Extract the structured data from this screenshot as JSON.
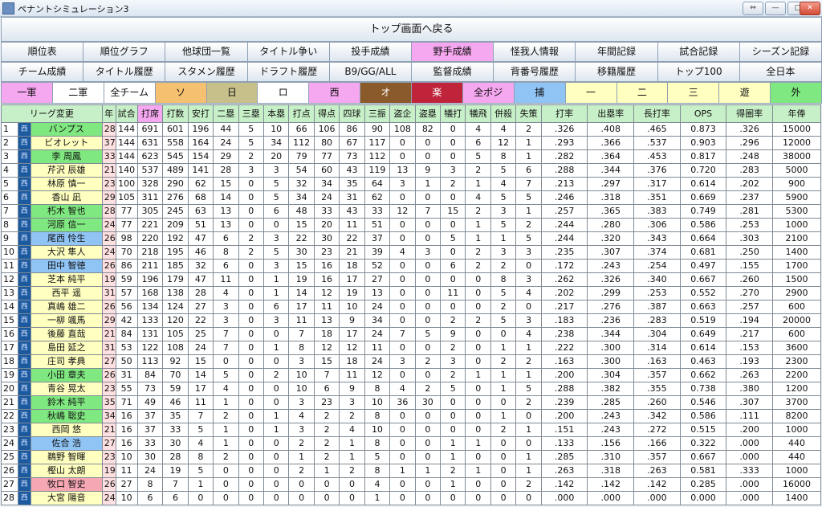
{
  "window": {
    "title": "ペナントシミュレーション3"
  },
  "top_button": "トップ画面へ戻る",
  "nav_row1": [
    "順位表",
    "順位グラフ",
    "他球団一覧",
    "タイトル争い",
    "投手成績",
    "野手成績",
    "怪我人情報",
    "年間記録",
    "試合記録",
    "シーズン記録"
  ],
  "nav_row2": [
    "チーム成績",
    "タイトル履歴",
    "スタメン履歴",
    "ドラフト履歴",
    "B9/GG/ALL",
    "監督成績",
    "背番号履歴",
    "移籍履歴",
    "トップ100",
    "全日本"
  ],
  "active_nav": "野手成績",
  "filters": [
    {
      "label": "一軍",
      "color": "#f5a7ef"
    },
    {
      "label": "二軍",
      "color": "#ffffff"
    },
    {
      "label": "全チーム",
      "color": "#ffffff"
    },
    {
      "label": "ソ",
      "color": "#f5c070"
    },
    {
      "label": "日",
      "color": "#c8c08a"
    },
    {
      "label": "ロ",
      "color": "#ffffff"
    },
    {
      "label": "西",
      "color": "#f5a7ef"
    },
    {
      "label": "オ",
      "color": "#8b5a2b"
    },
    {
      "label": "楽",
      "color": "#c0243a"
    },
    {
      "label": "全ポジ",
      "color": "#f5a7ef"
    },
    {
      "label": "捕",
      "color": "#8fc4f5"
    },
    {
      "label": "一",
      "color": "#ffffc0"
    },
    {
      "label": "二",
      "color": "#ffffc0"
    },
    {
      "label": "三",
      "color": "#ffffc0"
    },
    {
      "label": "遊",
      "color": "#ffffc0"
    },
    {
      "label": "外",
      "color": "#80e880"
    }
  ],
  "table": {
    "columns": [
      "リーグ変更",
      "年",
      "試合",
      "打席",
      "打数",
      "安打",
      "二塁",
      "三塁",
      "本塁",
      "打点",
      "得点",
      "四球",
      "三振",
      "盗企",
      "盗塁",
      "犠打",
      "犠飛",
      "併殺",
      "失策",
      "打率",
      "出塁率",
      "長打率",
      "OPS",
      "得圏率",
      "年俸"
    ],
    "team_code": "西",
    "rows": [
      {
        "no": "1",
        "name": "バンプス",
        "pos": "外",
        "cells": [
          "28",
          "144",
          "691",
          "601",
          "196",
          "44",
          "5",
          "10",
          "66",
          "106",
          "86",
          "90",
          "108",
          "82",
          "0",
          "4",
          "4",
          "2",
          ".326",
          ".408",
          ".465",
          "0.873",
          ".326",
          "15000"
        ]
      },
      {
        "no": "2",
        "name": "ビオレット",
        "pos": "一",
        "cells": [
          "37",
          "144",
          "631",
          "558",
          "164",
          "24",
          "5",
          "34",
          "112",
          "80",
          "67",
          "117",
          "0",
          "0",
          "0",
          "6",
          "12",
          "1",
          ".293",
          ".366",
          ".537",
          "0.903",
          ".296",
          "12000"
        ]
      },
      {
        "no": "3",
        "name": "李 周鳳",
        "pos": "外",
        "cells": [
          "33",
          "144",
          "623",
          "545",
          "154",
          "29",
          "2",
          "20",
          "79",
          "77",
          "73",
          "112",
          "0",
          "0",
          "0",
          "5",
          "8",
          "1",
          ".282",
          ".364",
          ".453",
          "0.817",
          ".248",
          "38000"
        ]
      },
      {
        "no": "4",
        "name": "芹沢 辰雄",
        "pos": "二",
        "cells": [
          "21",
          "140",
          "537",
          "489",
          "141",
          "28",
          "3",
          "3",
          "54",
          "60",
          "43",
          "119",
          "13",
          "9",
          "3",
          "2",
          "5",
          "6",
          ".288",
          ".344",
          ".376",
          "0.720",
          ".283",
          "5000"
        ]
      },
      {
        "no": "5",
        "name": "林原 慎一",
        "pos": "三",
        "cells": [
          "23",
          "100",
          "328",
          "290",
          "62",
          "15",
          "0",
          "5",
          "32",
          "34",
          "35",
          "64",
          "3",
          "1",
          "2",
          "1",
          "4",
          "7",
          ".213",
          ".297",
          ".317",
          "0.614",
          ".202",
          "900"
        ]
      },
      {
        "no": "6",
        "name": "香山 凪",
        "pos": "一",
        "cells": [
          "29",
          "105",
          "311",
          "276",
          "68",
          "14",
          "0",
          "5",
          "34",
          "24",
          "31",
          "62",
          "0",
          "0",
          "0",
          "4",
          "5",
          "5",
          ".246",
          ".318",
          ".351",
          "0.669",
          ".237",
          "5900"
        ]
      },
      {
        "no": "7",
        "name": "朽木 智也",
        "pos": "外",
        "cells": [
          "28",
          "77",
          "305",
          "245",
          "63",
          "13",
          "0",
          "6",
          "48",
          "33",
          "43",
          "33",
          "12",
          "7",
          "15",
          "2",
          "3",
          "1",
          ".257",
          ".365",
          ".383",
          "0.749",
          ".281",
          "5300"
        ]
      },
      {
        "no": "8",
        "name": "河原 信一",
        "pos": "外",
        "cells": [
          "24",
          "77",
          "221",
          "209",
          "51",
          "13",
          "0",
          "0",
          "15",
          "20",
          "11",
          "51",
          "0",
          "0",
          "0",
          "1",
          "5",
          "2",
          ".244",
          ".280",
          ".306",
          "0.586",
          ".253",
          "1000"
        ]
      },
      {
        "no": "9",
        "name": "尾西 怜生",
        "pos": "捕",
        "cells": [
          "26",
          "98",
          "220",
          "192",
          "47",
          "6",
          "2",
          "3",
          "22",
          "30",
          "22",
          "37",
          "0",
          "0",
          "5",
          "1",
          "1",
          "5",
          ".244",
          ".320",
          ".343",
          "0.664",
          ".303",
          "2100"
        ]
      },
      {
        "no": "10",
        "name": "大沢 隼人",
        "pos": "遊",
        "cells": [
          "24",
          "70",
          "218",
          "195",
          "46",
          "8",
          "2",
          "5",
          "30",
          "23",
          "21",
          "39",
          "4",
          "3",
          "0",
          "2",
          "3",
          "3",
          ".235",
          ".307",
          ".374",
          "0.681",
          ".250",
          "1400"
        ]
      },
      {
        "no": "11",
        "name": "田中 智徳",
        "pos": "捕",
        "cells": [
          "26",
          "86",
          "211",
          "185",
          "32",
          "6",
          "0",
          "3",
          "15",
          "16",
          "18",
          "52",
          "0",
          "0",
          "6",
          "2",
          "2",
          "0",
          ".172",
          ".243",
          ".254",
          "0.497",
          ".155",
          "1700"
        ]
      },
      {
        "no": "12",
        "name": "芝本 純平",
        "pos": "一",
        "cells": [
          "19",
          "59",
          "196",
          "179",
          "47",
          "11",
          "0",
          "1",
          "19",
          "16",
          "17",
          "27",
          "0",
          "0",
          "0",
          "0",
          "8",
          "3",
          ".262",
          ".326",
          ".340",
          "0.667",
          ".260",
          "1500"
        ]
      },
      {
        "no": "13",
        "name": "西平 遥",
        "pos": "一",
        "cells": [
          "31",
          "57",
          "168",
          "138",
          "28",
          "4",
          "0",
          "1",
          "14",
          "12",
          "19",
          "13",
          "0",
          "0",
          "11",
          "0",
          "5",
          "4",
          ".202",
          ".299",
          ".253",
          "0.552",
          ".270",
          "2900"
        ]
      },
      {
        "no": "14",
        "name": "真嶋 雄二",
        "pos": "一",
        "cells": [
          "26",
          "56",
          "134",
          "124",
          "27",
          "3",
          "0",
          "6",
          "17",
          "11",
          "10",
          "24",
          "0",
          "0",
          "0",
          "0",
          "2",
          "0",
          ".217",
          ".276",
          ".387",
          "0.663",
          ".257",
          "600"
        ]
      },
      {
        "no": "15",
        "name": "一柳 颯馬",
        "pos": "一",
        "cells": [
          "29",
          "42",
          "133",
          "120",
          "22",
          "3",
          "0",
          "3",
          "11",
          "13",
          "9",
          "34",
          "0",
          "0",
          "2",
          "2",
          "5",
          "3",
          ".183",
          ".236",
          ".283",
          "0.519",
          ".194",
          "20000"
        ]
      },
      {
        "no": "16",
        "name": "後藤 直哉",
        "pos": "二",
        "cells": [
          "21",
          "84",
          "131",
          "105",
          "25",
          "7",
          "0",
          "0",
          "7",
          "18",
          "17",
          "24",
          "7",
          "5",
          "9",
          "0",
          "0",
          "4",
          ".238",
          ".344",
          ".304",
          "0.649",
          ".217",
          "600"
        ]
      },
      {
        "no": "17",
        "name": "島田 延之",
        "pos": "一",
        "cells": [
          "31",
          "53",
          "122",
          "108",
          "24",
          "7",
          "0",
          "1",
          "8",
          "12",
          "12",
          "11",
          "0",
          "0",
          "2",
          "0",
          "1",
          "1",
          ".222",
          ".300",
          ".314",
          "0.614",
          ".153",
          "3600"
        ]
      },
      {
        "no": "18",
        "name": "庄司 孝典",
        "pos": "二",
        "cells": [
          "27",
          "50",
          "113",
          "92",
          "15",
          "0",
          "0",
          "0",
          "3",
          "15",
          "18",
          "24",
          "3",
          "2",
          "3",
          "0",
          "2",
          "2",
          ".163",
          ".300",
          ".163",
          "0.463",
          ".193",
          "2300"
        ]
      },
      {
        "no": "19",
        "name": "小田 章夫",
        "pos": "外",
        "cells": [
          "26",
          "31",
          "84",
          "70",
          "14",
          "5",
          "0",
          "2",
          "10",
          "7",
          "11",
          "12",
          "0",
          "0",
          "2",
          "1",
          "1",
          "1",
          ".200",
          ".304",
          ".357",
          "0.662",
          ".263",
          "2200"
        ]
      },
      {
        "no": "20",
        "name": "青谷 晃太",
        "pos": "二",
        "cells": [
          "23",
          "55",
          "73",
          "59",
          "17",
          "4",
          "0",
          "0",
          "10",
          "6",
          "9",
          "8",
          "4",
          "2",
          "5",
          "0",
          "1",
          "5",
          ".288",
          ".382",
          ".355",
          "0.738",
          ".380",
          "1200"
        ]
      },
      {
        "no": "21",
        "name": "鈴木 純平",
        "pos": "外",
        "cells": [
          "35",
          "71",
          "49",
          "46",
          "11",
          "1",
          "0",
          "0",
          "3",
          "23",
          "3",
          "10",
          "36",
          "30",
          "0",
          "0",
          "0",
          "2",
          ".239",
          ".285",
          ".260",
          "0.546",
          ".307",
          "3700"
        ]
      },
      {
        "no": "22",
        "name": "秋嶋 聡史",
        "pos": "外",
        "cells": [
          "34",
          "16",
          "37",
          "35",
          "7",
          "2",
          "0",
          "1",
          "4",
          "2",
          "2",
          "8",
          "0",
          "0",
          "0",
          "0",
          "1",
          "0",
          ".200",
          ".243",
          ".342",
          "0.586",
          ".111",
          "8200"
        ]
      },
      {
        "no": "23",
        "name": "西岡 悠",
        "pos": "一",
        "cells": [
          "21",
          "16",
          "37",
          "33",
          "5",
          "1",
          "0",
          "1",
          "3",
          "2",
          "4",
          "10",
          "0",
          "0",
          "0",
          "0",
          "2",
          "1",
          ".151",
          ".243",
          ".272",
          "0.515",
          ".200",
          "1000"
        ]
      },
      {
        "no": "24",
        "name": "佐合 浩",
        "pos": "捕",
        "cells": [
          "27",
          "16",
          "33",
          "30",
          "4",
          "1",
          "0",
          "0",
          "2",
          "2",
          "1",
          "8",
          "0",
          "0",
          "1",
          "1",
          "0",
          "0",
          ".133",
          ".156",
          ".166",
          "0.322",
          ".000",
          "440"
        ]
      },
      {
        "no": "25",
        "name": "鵜野 智暉",
        "pos": "一",
        "cells": [
          "23",
          "10",
          "30",
          "28",
          "8",
          "2",
          "0",
          "0",
          "1",
          "2",
          "1",
          "5",
          "0",
          "0",
          "1",
          "0",
          "0",
          "1",
          ".285",
          ".310",
          ".357",
          "0.667",
          ".000",
          "440"
        ]
      },
      {
        "no": "26",
        "name": "樫山 太朗",
        "pos": "二",
        "cells": [
          "19",
          "11",
          "24",
          "19",
          "5",
          "0",
          "0",
          "0",
          "2",
          "1",
          "2",
          "8",
          "1",
          "1",
          "2",
          "1",
          "0",
          "1",
          ".263",
          ".318",
          ".263",
          "0.581",
          ".333",
          "1000"
        ]
      },
      {
        "no": "27",
        "name": "牧口 智史",
        "pos": "投",
        "cells": [
          "26",
          "27",
          "8",
          "7",
          "1",
          "0",
          "0",
          "0",
          "0",
          "0",
          "0",
          "4",
          "0",
          "0",
          "1",
          "0",
          "0",
          "2",
          ".142",
          ".142",
          ".142",
          "0.285",
          ".000",
          "16000"
        ]
      },
      {
        "no": "28",
        "name": "大宮 陽音",
        "pos": "一",
        "cells": [
          "24",
          "10",
          "6",
          "6",
          "0",
          "0",
          "0",
          "0",
          "0",
          "0",
          "0",
          "1",
          "0",
          "0",
          "0",
          "0",
          "0",
          "0",
          ".000",
          ".000",
          ".000",
          "0.000",
          ".000",
          "1400"
        ]
      }
    ]
  },
  "pos_colors": {
    "外": "#80e880",
    "一": "#ffffc0",
    "二": "#ffffc0",
    "三": "#ffffc0",
    "遊": "#ffffc0",
    "捕": "#8fc4f5",
    "投": "#f5a7b4"
  }
}
